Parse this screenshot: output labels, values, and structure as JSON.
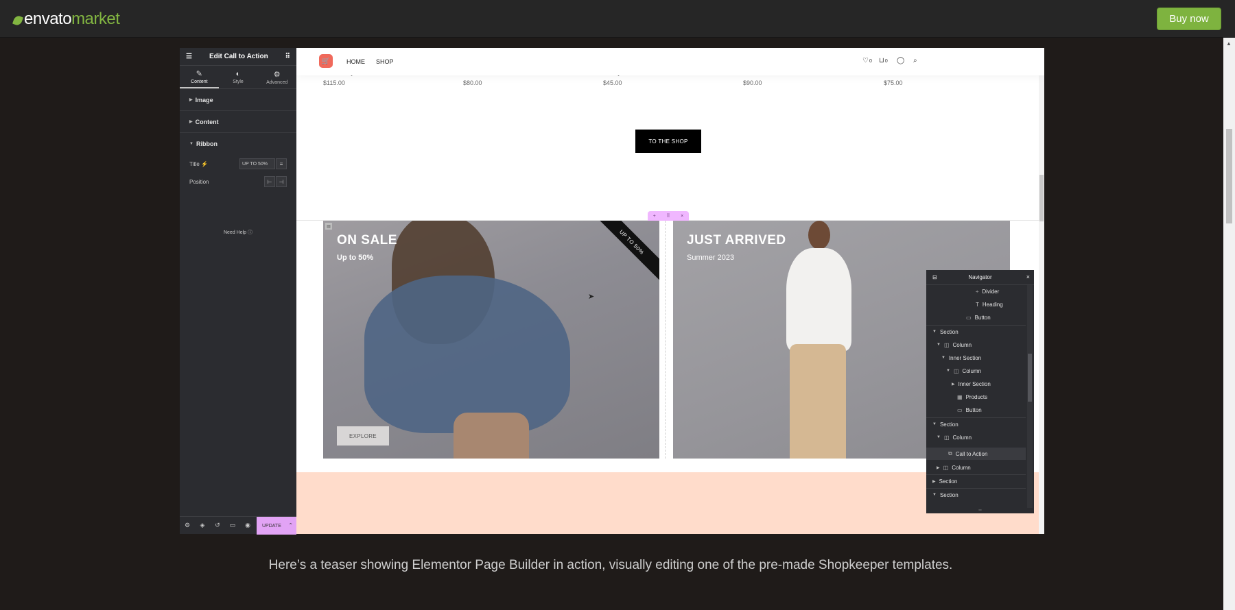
{
  "brand": {
    "word1": "envato",
    "word2": "market"
  },
  "header": {
    "buy_label": "Buy now"
  },
  "panel": {
    "title": "Edit Call to Action",
    "tabs": [
      {
        "label": "Content",
        "icon": "pencil-icon"
      },
      {
        "label": "Style",
        "icon": "contrast-icon"
      },
      {
        "label": "Advanced",
        "icon": "gear-icon"
      }
    ],
    "sections": [
      "Image",
      "Content",
      "Ribbon"
    ],
    "title_label": "Title",
    "title_value": "UP TO 50%",
    "position_label": "Position",
    "help": "Need Help",
    "update": "UPDATE"
  },
  "site": {
    "nav": [
      "HOME",
      "SHOP"
    ],
    "wish_count": "0",
    "cart_count": "0",
    "prices": [
      "$115.00",
      "$80.00",
      "$45.00",
      "$90.00",
      "$75.00"
    ],
    "shop_button": "TO THE SHOP",
    "sale": {
      "title": "ON SALE",
      "subtitle": "Up to 50%",
      "button": "EXPLORE",
      "ribbon": "UP TO 50%"
    },
    "arrived": {
      "title": "JUST ARRIVED",
      "subtitle": "Summer 2023"
    }
  },
  "navigator": {
    "title": "Navigator",
    "items": [
      {
        "label": "Divider",
        "icon": "divider-icon"
      },
      {
        "label": "Heading",
        "icon": "heading-icon"
      },
      {
        "label": "Button",
        "icon": "button-icon"
      },
      {
        "label": "Section"
      },
      {
        "label": "Column"
      },
      {
        "label": "Inner Section"
      },
      {
        "label": "Column"
      },
      {
        "label": "Inner Section"
      },
      {
        "label": "Products"
      },
      {
        "label": "Button"
      },
      {
        "label": "Section"
      },
      {
        "label": "Column"
      },
      {
        "label": "Call to Action"
      },
      {
        "label": "Column"
      },
      {
        "label": "Section"
      },
      {
        "label": "Section"
      }
    ]
  },
  "caption": "Here’s a teaser showing Elementor Page Builder in action, visually editing one of the pre-made Shopkeeper templates."
}
